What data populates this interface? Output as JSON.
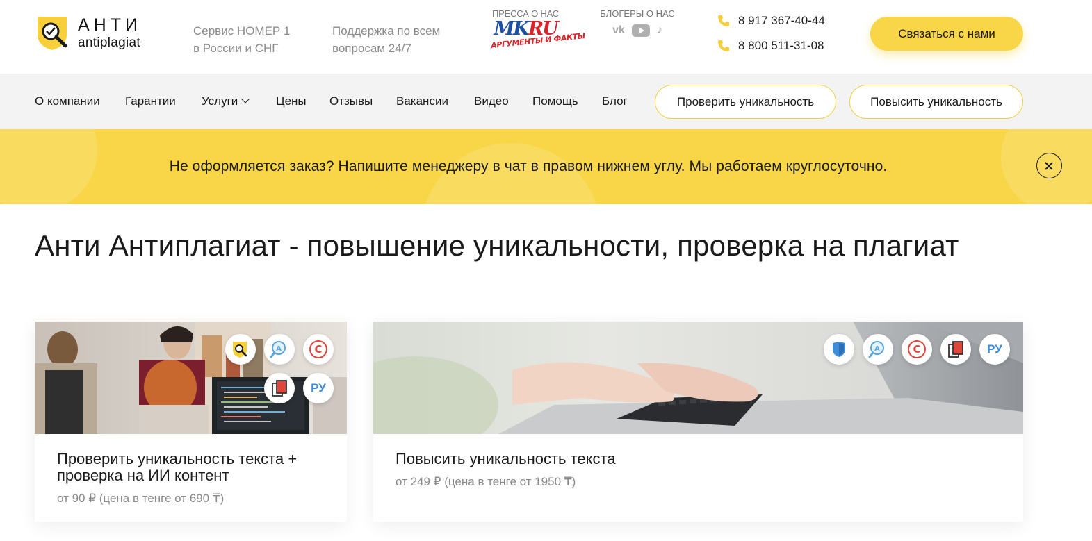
{
  "header": {
    "logo_top": "АНТИ",
    "logo_bottom": "antiplagiat",
    "tagline1": [
      "Сервис НОМЕР 1",
      "в России и СНГ"
    ],
    "tagline2": [
      "Поддержка по всем",
      "вопросам 24/7"
    ],
    "press_title": "ПРЕССА О НАС",
    "press_mk_a": "MK",
    "press_mk_b": "RU",
    "press_aif": "АРГУМЕНТЫ И ФАКТЫ",
    "bloggers_title": "БЛОГЕРЫ О НАС",
    "social_vk": "vk",
    "social_tiktok": "♪",
    "phones": [
      "8 917 367-40-44",
      "8 800 511-31-08"
    ],
    "contact_label": "Связаться с нами"
  },
  "nav": {
    "items": [
      "О компании",
      "Гарантии",
      "Услуги",
      "Цены",
      "Отзывы",
      "Вакансии",
      "Видео",
      "Помощь",
      "Блог"
    ],
    "check_btn": "Проверить уникальность",
    "raise_btn": "Повысить уникальность"
  },
  "banner": {
    "text": "Не оформляется заказ? Напишите менеджеру в чат в правом нижнем углу. Мы работаем круглосуточно."
  },
  "page_title": "Анти Антиплагиат - повышение уникальности, проверка на плагиат",
  "cards": [
    {
      "title_lines": [
        "Проверить уникальность текста +",
        "проверка на ИИ контент"
      ],
      "price": "от 90 ₽ (цена в тенге от 690 ₸)",
      "badge_ru": "РУ"
    },
    {
      "title_lines": [
        "Повысить уникальность текста"
      ],
      "price": "от 249 ₽ (цена в тенге от 1950 ₸)",
      "badge_ru": "РУ"
    }
  ],
  "colors": {
    "accent": "#f9d648",
    "nav_bg": "#f3f3f3",
    "muted_text": "#8a8a8a"
  }
}
